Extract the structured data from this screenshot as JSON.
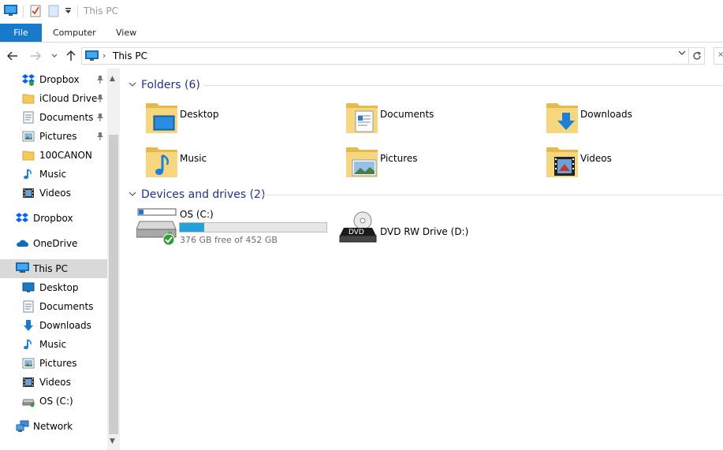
{
  "window": {
    "title": "This PC"
  },
  "ribbon": {
    "file": "File",
    "computer": "Computer",
    "view": "View"
  },
  "address": {
    "path": "This PC"
  },
  "sidebar": {
    "quick_access": [
      {
        "label": "Dropbox",
        "icon": "dropbox-icon",
        "pinned": true
      },
      {
        "label": "iCloud Drive",
        "icon": "folder-icon",
        "pinned": true
      },
      {
        "label": "Documents",
        "icon": "documents-icon",
        "pinned": true
      },
      {
        "label": "Pictures",
        "icon": "pictures-icon",
        "pinned": true
      },
      {
        "label": "100CANON",
        "icon": "folder-icon",
        "pinned": false
      },
      {
        "label": "Music",
        "icon": "music-icon",
        "pinned": false
      },
      {
        "label": "Videos",
        "icon": "videos-icon",
        "pinned": false
      }
    ],
    "dropbox": "Dropbox",
    "onedrive": "OneDrive",
    "this_pc": "This PC",
    "this_pc_children": [
      {
        "label": "Desktop",
        "icon": "desktop-icon"
      },
      {
        "label": "Documents",
        "icon": "documents-icon"
      },
      {
        "label": "Downloads",
        "icon": "downloads-icon"
      },
      {
        "label": "Music",
        "icon": "music-icon"
      },
      {
        "label": "Pictures",
        "icon": "pictures-icon"
      },
      {
        "label": "Videos",
        "icon": "videos-icon"
      },
      {
        "label": "OS (C:)",
        "icon": "drive-icon"
      }
    ],
    "network": "Network"
  },
  "content": {
    "folders_header": "Folders (6)",
    "folders": [
      {
        "label": "Desktop",
        "icon": "desktop-folder-icon"
      },
      {
        "label": "Documents",
        "icon": "documents-folder-icon"
      },
      {
        "label": "Downloads",
        "icon": "downloads-folder-icon"
      },
      {
        "label": "Music",
        "icon": "music-folder-icon"
      },
      {
        "label": "Pictures",
        "icon": "pictures-folder-icon"
      },
      {
        "label": "Videos",
        "icon": "videos-folder-icon"
      }
    ],
    "devices_header": "Devices and drives (2)",
    "drives": [
      {
        "label": "OS (C:)",
        "free_text": "376 GB free of 452 GB",
        "used_fraction": 0.168
      },
      {
        "label": "DVD RW Drive (D:)",
        "badge": "DVD"
      }
    ]
  },
  "colors": {
    "accent": "#1979ca",
    "group_header": "#1e3287",
    "selection": "#d9d9d9",
    "bar_fill": "#26a0da",
    "folder": "#f4c95d"
  }
}
